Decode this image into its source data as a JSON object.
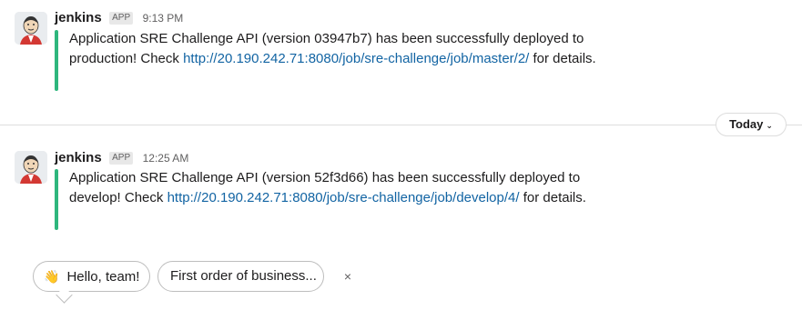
{
  "messages": [
    {
      "sender": "jenkins",
      "badge": "APP",
      "time": "9:13 PM",
      "text_before": "Application SRE Challenge API (version 03947b7) has been successfully deployed to production! Check ",
      "link": "http://20.190.242.71:8080/job/sre-challenge/job/master/2/",
      "text_after": " for details."
    },
    {
      "sender": "jenkins",
      "badge": "APP",
      "time": "12:25 AM",
      "text_before": "Application SRE Challenge API (version 52f3d66) has been successfully deployed to develop! Check ",
      "link": "http://20.190.242.71:8080/job/sre-challenge/job/develop/4/",
      "text_after": " for details."
    }
  ],
  "date_divider": {
    "label": "Today"
  },
  "suggestions": {
    "chip1_emoji": "👋",
    "chip1_label": "Hello, team!",
    "chip2_label": "First order of business...",
    "close": "×"
  },
  "colors": {
    "accent_bar": "#2eb67d",
    "link": "#1264a3"
  }
}
